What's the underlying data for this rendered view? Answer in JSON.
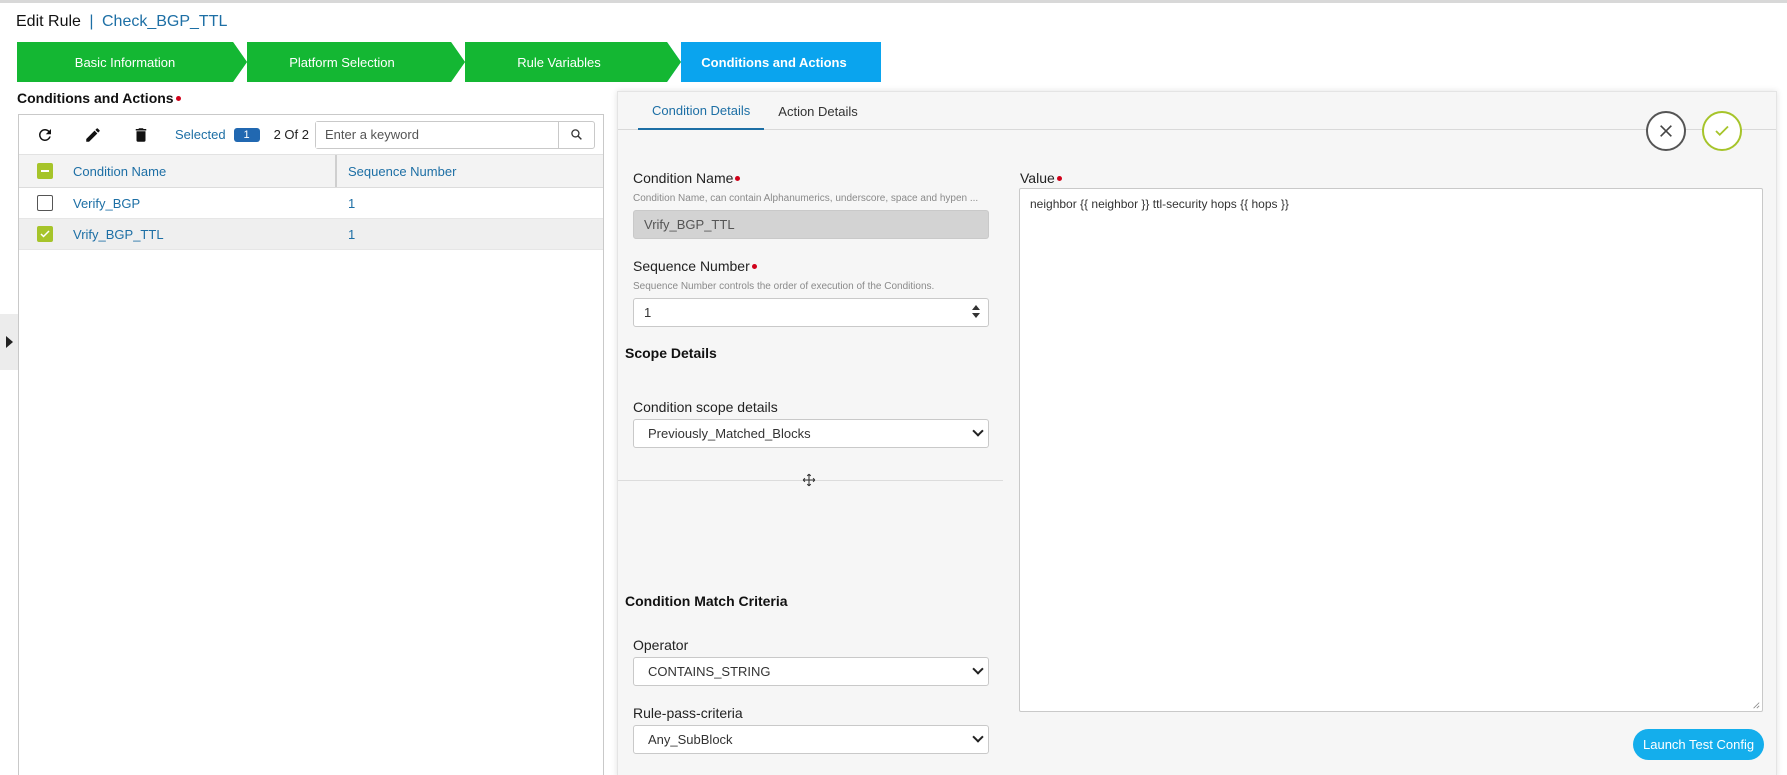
{
  "header": {
    "title": "Edit Rule",
    "separator": "|",
    "rule_name": "Check_BGP_TTL"
  },
  "wizard": {
    "steps": [
      {
        "label": "Basic Information",
        "state": "complete"
      },
      {
        "label": "Platform Selection",
        "state": "complete"
      },
      {
        "label": "Rule Variables",
        "state": "complete"
      },
      {
        "label": "Conditions and Actions",
        "state": "active"
      }
    ]
  },
  "left": {
    "section_label": "Conditions and Actions",
    "toolbar": {
      "refresh_icon": "refresh-icon",
      "edit_icon": "pencil-icon",
      "delete_icon": "trash-icon",
      "selected_label": "Selected",
      "selected_count": "1",
      "of_count": "2 Of 2",
      "search_placeholder": "Enter a keyword"
    },
    "grid": {
      "columns": [
        "Condition Name",
        "Sequence Number"
      ],
      "rows": [
        {
          "name": "Verify_BGP",
          "sequence": "1",
          "checked": false
        },
        {
          "name": "Vrify_BGP_TTL",
          "sequence": "1",
          "checked": true
        }
      ]
    }
  },
  "detail": {
    "tabs": [
      "Condition Details",
      "Action Details"
    ],
    "active_tab": "Condition Details",
    "condition_name": {
      "label": "Condition Name",
      "help": "Condition Name, can contain Alphanumerics, underscore, space and hypen ...",
      "value": "Vrify_BGP_TTL"
    },
    "sequence_number": {
      "label": "Sequence Number",
      "help": "Sequence Number controls the order of execution of the Conditions.",
      "value": "1"
    },
    "scope": {
      "title": "Scope Details",
      "label": "Condition scope details",
      "value": "Previously_Matched_Blocks"
    },
    "match": {
      "title": "Condition Match Criteria",
      "operator_label": "Operator",
      "operator_value": "CONTAINS_STRING",
      "pass_label": "Rule-pass-criteria",
      "pass_value": "Any_SubBlock"
    },
    "value": {
      "label": "Value",
      "text": "neighbor {{ neighbor }} ttl-security hops {{ hops }}"
    },
    "launch_button": "Launch Test Config"
  },
  "colors": {
    "step_complete": "#14b733",
    "step_active": "#0aa4ee",
    "link_blue": "#1d6fa5",
    "required": "#d0021b",
    "check_green": "#a6c42a"
  }
}
